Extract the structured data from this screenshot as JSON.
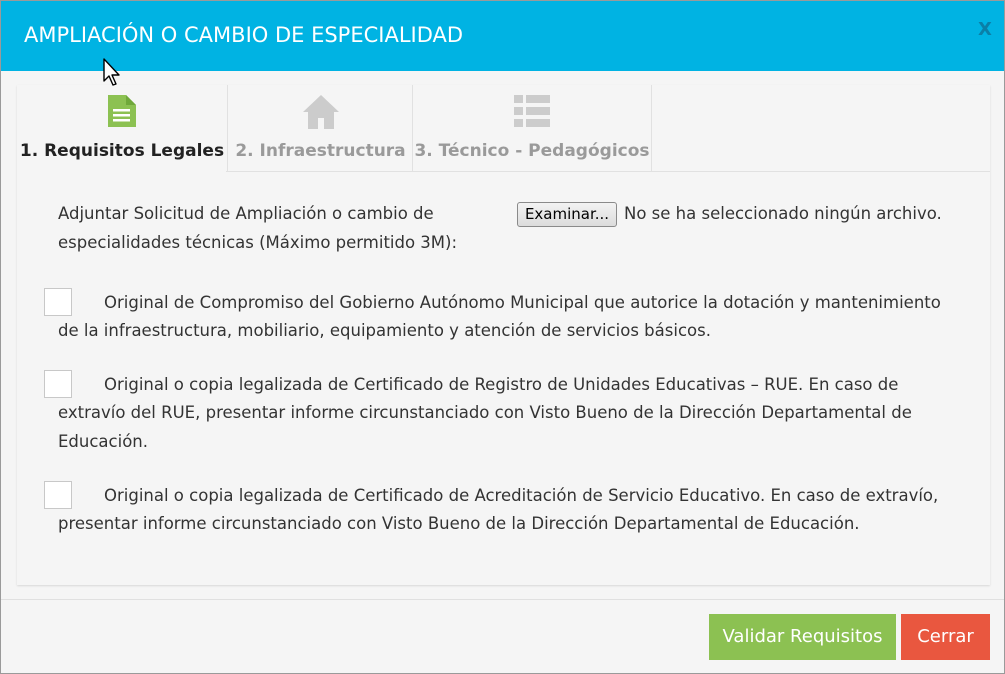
{
  "dialog": {
    "title": "AMPLIACIÓN O CAMBIO DE ESPECIALIDAD",
    "close_label": "X"
  },
  "tabs": [
    {
      "label": "1. Requisitos Legales",
      "icon": "document-icon",
      "active": true,
      "color": "#8cc152"
    },
    {
      "label": "2. Infraestructura",
      "icon": "home-icon",
      "active": false,
      "color": "#cccccc"
    },
    {
      "label": "3. Técnico - Pedagógicos",
      "icon": "list-icon",
      "active": false,
      "color": "#cccccc"
    }
  ],
  "upload": {
    "label_line1": "Adjuntar Solicitud de Ampliación o cambio de",
    "label_line2": "especialidades técnicas (Máximo permitido 3M):",
    "button_label": "Examinar...",
    "status": "No se ha seleccionado ningún archivo."
  },
  "requirements": [
    {
      "checked": false,
      "lines": [
        "Original de Compromiso del Gobierno Autónomo Municipal que autorice la dotación y mantenimiento",
        "de la infraestructura, mobiliario, equipamiento y atención de servicios básicos."
      ]
    },
    {
      "checked": false,
      "lines": [
        "Original o copia legalizada de Certificado de Registro de Unidades Educativas – RUE. En caso de",
        "extravío del RUE, presentar informe circunstanciado con Visto Bueno de la Dirección Departamental de",
        "Educación."
      ]
    },
    {
      "checked": false,
      "lines": [
        "Original o copia legalizada de Certificado de Acreditación de Servicio Educativo. En caso de extravío,",
        "presentar informe circunstanciado con Visto Bueno de la Dirección Departamental de Educación."
      ]
    }
  ],
  "footer": {
    "validate_label": "Validar Requisitos",
    "close_label": "Cerrar"
  },
  "colors": {
    "header": "#00b3e3",
    "validate": "#8cc152",
    "close": "#e9573f"
  }
}
